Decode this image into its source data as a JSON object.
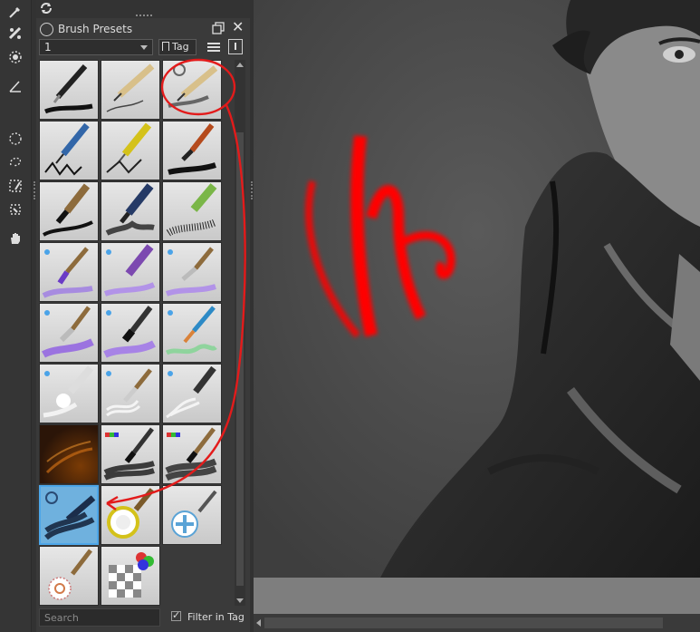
{
  "toolbar": {
    "tools": [
      {
        "name": "eyedropper-icon"
      },
      {
        "name": "smart-patch-icon"
      },
      {
        "name": "fill-icon"
      },
      {
        "name": "measure-icon"
      },
      {
        "name": "ellipse-select-icon"
      },
      {
        "name": "freehand-select-icon"
      },
      {
        "name": "similar-select-icon"
      },
      {
        "name": "magnetic-select-icon"
      },
      {
        "name": "pan-hand-icon"
      }
    ]
  },
  "panel": {
    "title": "Brush Presets",
    "combo_value": "1",
    "tag_label": "Tag",
    "search_placeholder": "Search",
    "filter_label": "Filter in Tag",
    "filter_checked": true
  },
  "presets": [
    {
      "name": "preset-ink-pen",
      "icon": "pen"
    },
    {
      "name": "preset-pencil",
      "icon": "pencil"
    },
    {
      "name": "preset-pencil-reload",
      "icon": "pencil-reload"
    },
    {
      "name": "preset-fineliner",
      "icon": "fineliner"
    },
    {
      "name": "preset-nib",
      "icon": "nib"
    },
    {
      "name": "preset-brush-black",
      "icon": "brush-black"
    },
    {
      "name": "preset-ink-brush",
      "icon": "ink-brush"
    },
    {
      "name": "preset-marker",
      "icon": "marker"
    },
    {
      "name": "preset-chalk",
      "icon": "chalk"
    },
    {
      "name": "preset-wet-brush-purple",
      "icon": "wet-purple"
    },
    {
      "name": "preset-wet-marker-purple",
      "icon": "wet-marker"
    },
    {
      "name": "preset-wet-knife",
      "icon": "wet-knife"
    },
    {
      "name": "preset-palette-knife",
      "icon": "knife-purple"
    },
    {
      "name": "preset-flat-brush",
      "icon": "flat-purple"
    },
    {
      "name": "preset-round-green",
      "icon": "round-green"
    },
    {
      "name": "preset-water-blob",
      "icon": "water-blob"
    },
    {
      "name": "preset-water-knife",
      "icon": "water-knife"
    },
    {
      "name": "preset-water-pen",
      "icon": "water-pen"
    },
    {
      "name": "preset-texture-dark",
      "icon": "texture-dark"
    },
    {
      "name": "preset-rgb-brush",
      "icon": "rgb-brush"
    },
    {
      "name": "preset-rgb-brush-2",
      "icon": "rgb-brush-2"
    },
    {
      "name": "preset-selected-blue",
      "icon": "blue-selected"
    },
    {
      "name": "preset-filter-circle",
      "icon": "filter-circle"
    },
    {
      "name": "preset-cross-pen",
      "icon": "cross-pen"
    },
    {
      "name": "preset-pattern-pen",
      "icon": "pattern-pen"
    },
    {
      "name": "preset-transparency",
      "icon": "transparency"
    }
  ],
  "colors": {
    "selection": "#4da6e8",
    "annotation": "#e31b1b"
  }
}
